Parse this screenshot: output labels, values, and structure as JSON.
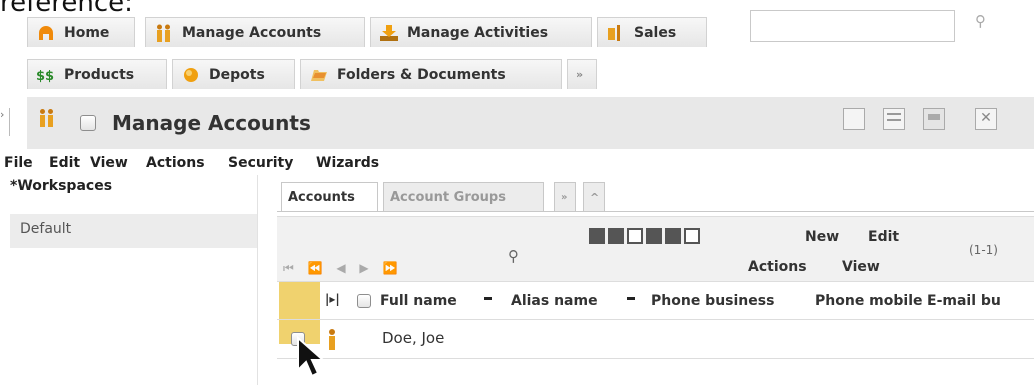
{
  "caption": "reference:",
  "nav": {
    "tabs_row1": [
      {
        "label": "Home"
      },
      {
        "label": "Manage Accounts"
      },
      {
        "label": "Manage Activities"
      },
      {
        "label": "Sales"
      }
    ],
    "tabs_row2": [
      {
        "label": "Products"
      },
      {
        "label": "Depots"
      },
      {
        "label": "Folders & Documents"
      },
      {
        "label": "»"
      }
    ],
    "search": {
      "value": "",
      "placeholder": ""
    }
  },
  "window": {
    "title": "Manage Accounts"
  },
  "menu": [
    "File",
    "Edit",
    "View",
    "Actions",
    "Security",
    "Wizards"
  ],
  "sidebar": {
    "title": "*Workspaces",
    "items": [
      "Default"
    ]
  },
  "inner_tabs": {
    "accounts": "Accounts",
    "account_groups": "Account Groups",
    "more": "»",
    "collapse": "^"
  },
  "toolbar": {
    "pager": "⏮ ⏪ ◀ ▶ ⏩",
    "new_label": "New",
    "actions_label": "Actions",
    "edit_label": "Edit",
    "view_label": "View",
    "count": "(1-1)"
  },
  "grid": {
    "columns": [
      "Full name",
      "Alias name",
      "Phone business",
      "Phone mobile",
      "E-mail bu"
    ],
    "rows": [
      {
        "full_name": "Doe, Joe"
      }
    ]
  },
  "colors": {
    "selection": "#f0d26e",
    "titlebar": "#e8e8e8",
    "toolbar": "#f1f1f1"
  }
}
